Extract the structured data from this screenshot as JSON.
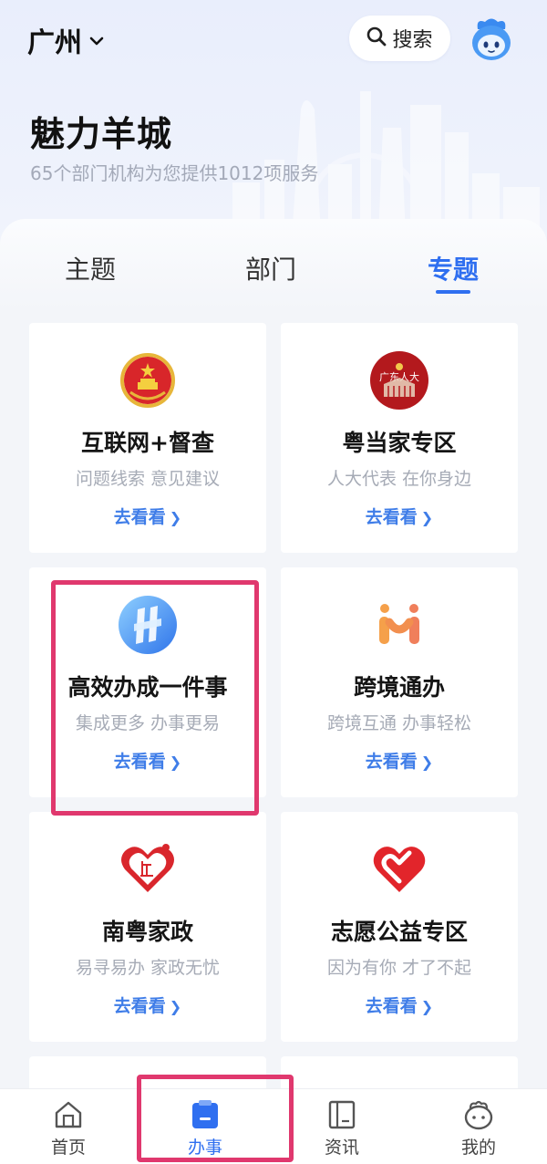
{
  "header": {
    "city": "广州",
    "search_label": "搜索",
    "title": "魅力羊城",
    "subtitle": "65个部门机构为您提供1012项服务"
  },
  "tabs": [
    {
      "label": "主题",
      "active": false
    },
    {
      "label": "部门",
      "active": false
    },
    {
      "label": "专题",
      "active": true
    }
  ],
  "cards": [
    {
      "title": "互联网+督查",
      "subtitle": "问题线索 意见建议",
      "link": "去看看",
      "icon": "national-emblem-icon"
    },
    {
      "title": "粤当家专区",
      "subtitle": "人大代表 在你身边",
      "link": "去看看",
      "icon": "guangdong-npc-icon",
      "icon_text": "广东人大"
    },
    {
      "title": "高效办成一件事",
      "subtitle": "集成更多 办事更易",
      "link": "去看看",
      "icon": "efficient-service-icon"
    },
    {
      "title": "跨境通办",
      "subtitle": "跨境互通 办事轻松",
      "link": "去看看",
      "icon": "cross-border-icon"
    },
    {
      "title": "南粤家政",
      "subtitle": "易寻易办 家政无忧",
      "link": "去看看",
      "icon": "nanyue-housekeeping-icon"
    },
    {
      "title": "志愿公益专区",
      "subtitle": "因为有你 才了不起",
      "link": "去看看",
      "icon": "volunteer-heart-icon"
    }
  ],
  "bottom_nav": [
    {
      "label": "首页",
      "icon": "home-icon",
      "active": false
    },
    {
      "label": "办事",
      "icon": "clipboard-icon",
      "active": true
    },
    {
      "label": "资讯",
      "icon": "news-book-icon",
      "active": false
    },
    {
      "label": "我的",
      "icon": "profile-mascot-icon",
      "active": false
    }
  ],
  "colors": {
    "accent": "#2f6ff0",
    "link": "#3f7de8",
    "highlight": "#e0386e",
    "background": "#f3f5f9"
  }
}
